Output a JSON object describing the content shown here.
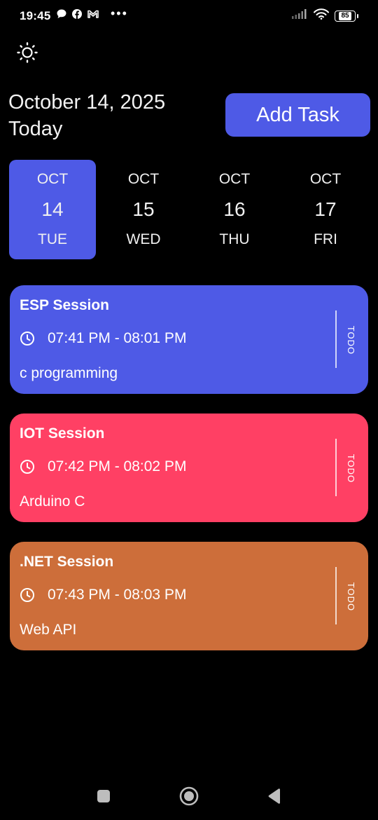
{
  "status_bar": {
    "time": "19:45",
    "left_icons": [
      "chat-bubble-icon",
      "facebook-icon",
      "gmail-icon"
    ],
    "more": "•••",
    "battery": "85"
  },
  "header": {
    "date": "October 14, 2025",
    "subtitle": "Today",
    "add_button": "Add Task"
  },
  "dates": [
    {
      "month": "OCT",
      "day": "14",
      "weekday": "TUE",
      "selected": true
    },
    {
      "month": "OCT",
      "day": "15",
      "weekday": "WED",
      "selected": false
    },
    {
      "month": "OCT",
      "day": "16",
      "weekday": "THU",
      "selected": false
    },
    {
      "month": "OCT",
      "day": "17",
      "weekday": "FRI",
      "selected": false
    }
  ],
  "tasks": [
    {
      "title": "ESP Session",
      "time": "07:41 PM - 08:01 PM",
      "note": "c programming",
      "status": "TODO",
      "color": "#4e5ae6"
    },
    {
      "title": "IOT Session",
      "time": "07:42 PM - 08:02 PM",
      "note": "Arduino C",
      "status": "TODO",
      "color": "#ff4064"
    },
    {
      "title": ".NET Session",
      "time": "07:43 PM - 08:03 PM",
      "note": "Web API",
      "status": "TODO",
      "color": "#cd6e3a"
    }
  ],
  "colors": {
    "accent": "#4e5ae6",
    "background": "#000000"
  }
}
